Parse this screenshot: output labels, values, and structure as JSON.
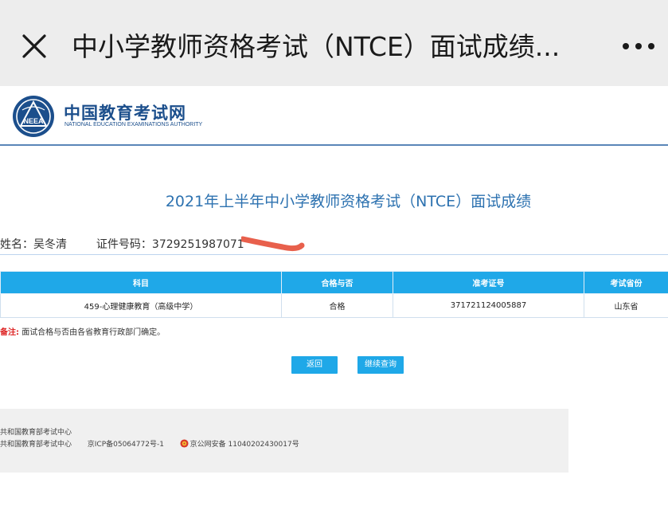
{
  "appbar": {
    "title": "中小学教师资格考试（NTCE）面试成绩..."
  },
  "header": {
    "logo_cn": "中国教育考试网",
    "logo_en": "NATIONAL EDUCATION EXAMINATIONS AUTHORITY",
    "seal_text": "NEEA"
  },
  "page": {
    "title": "2021年上半年中小学教师资格考试（NTCE）面试成绩"
  },
  "person": {
    "name_label": "姓名：",
    "name_value": "吴冬清",
    "id_label": "证件号码：",
    "id_value": "3729251987071"
  },
  "table": {
    "headers": [
      "科目",
      "合格与否",
      "准考证号",
      "考试省份"
    ],
    "rows": [
      [
        "459-心理健康教育（高级中学）",
        "合格",
        "371721124005887",
        "山东省"
      ]
    ]
  },
  "remark": {
    "tag": "备注:",
    "text": "面试合格与否由各省教育行政部门确定。"
  },
  "buttons": {
    "back": "返回",
    "continue": "继续查询"
  },
  "footer": {
    "line1": "共和国教育部考试中心",
    "line2_part1": "共和国教育部考试中心",
    "line2_part2": "京ICP备05064772号-1",
    "line2_part3": "京公网安备 11040202430017号"
  },
  "colors": {
    "accent": "#1fa8e8",
    "title_blue": "#2d72b0",
    "brand_blue": "#1c4f8c",
    "redaction": "#e8604c"
  }
}
